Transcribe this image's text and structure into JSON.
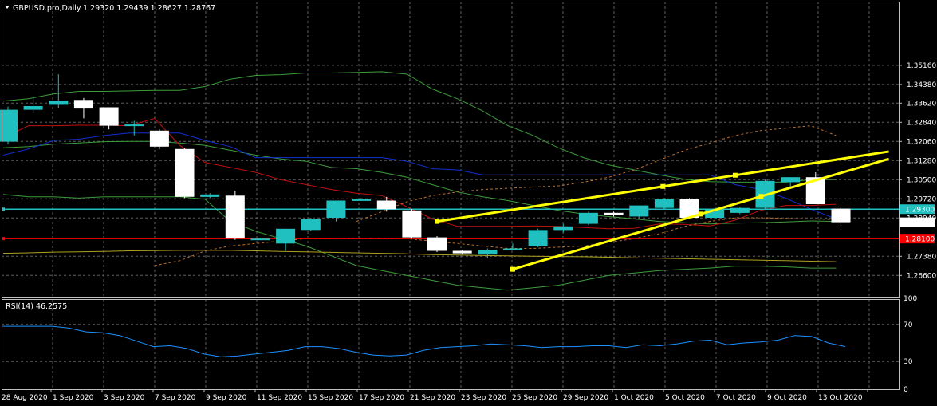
{
  "chart_data": {
    "type": "candlestick",
    "title": "GBPUSD.pro,Daily",
    "ohlc_text": "1.29320 1.29439 1.28627 1.28767",
    "subpanel_title": "RSI(14) 46.2575",
    "y_ticks": [
      "1.35160",
      "1.34380",
      "1.33620",
      "1.32840",
      "1.32060",
      "1.31280",
      "1.30500",
      "1.29720",
      "1.28940",
      "1.27380",
      "1.26600"
    ],
    "ylim": [
      1.266,
      1.3516
    ],
    "x_ticks": [
      "28 Aug 2020",
      "1 Sep 2020",
      "3 Sep 2020",
      "7 Sep 2020",
      "9 Sep 2020",
      "11 Sep 2020",
      "15 Sep 2020",
      "17 Sep 2020",
      "21 Sep 2020",
      "23 Sep 2020",
      "25 Sep 2020",
      "29 Sep 2020",
      "1 Oct 2020",
      "5 Oct 2020",
      "7 Oct 2020",
      "9 Oct 2020",
      "13 Oct 2020"
    ],
    "rsi_ticks": [
      "100",
      "70",
      "30",
      "0"
    ],
    "rsi_value": 46.2575,
    "price_tags": [
      {
        "label": "1.29300",
        "value": 1.293,
        "color": "#20c0c0"
      },
      {
        "label": "1.28767",
        "value": 1.28767,
        "color": "#ffffff"
      },
      {
        "label": "1.28100",
        "value": 1.281,
        "color": "#ff0000"
      }
    ],
    "candles": [
      {
        "date": "27 Aug 2020",
        "open": 1.3205,
        "high": 1.3348,
        "low": 1.3195,
        "close": 1.3335
      },
      {
        "date": "28 Aug 2020",
        "open": 1.3335,
        "high": 1.339,
        "low": 1.332,
        "close": 1.335
      },
      {
        "date": "31 Aug 2020",
        "open": 1.3355,
        "high": 1.348,
        "low": 1.334,
        "close": 1.3372
      },
      {
        "date": "1 Sep 2020",
        "open": 1.3375,
        "high": 1.3383,
        "low": 1.33,
        "close": 1.334
      },
      {
        "date": "2 Sep 2020",
        "open": 1.3345,
        "high": 1.3345,
        "low": 1.3255,
        "close": 1.327
      },
      {
        "date": "3 Sep 2020",
        "open": 1.327,
        "high": 1.329,
        "low": 1.323,
        "close": 1.3275
      },
      {
        "date": "4 Sep 2020",
        "open": 1.325,
        "high": 1.3255,
        "low": 1.3175,
        "close": 1.3185
      },
      {
        "date": "7 Sep 2020",
        "open": 1.3175,
        "high": 1.318,
        "low": 1.2975,
        "close": 1.298
      },
      {
        "date": "8 Sep 2020",
        "open": 1.298,
        "high": 1.2995,
        "low": 1.2975,
        "close": 1.299
      },
      {
        "date": "9 Sep 2020",
        "open": 1.2985,
        "high": 1.3005,
        "low": 1.2805,
        "close": 1.281
      },
      {
        "date": "10 Sep 2020",
        "open": 1.281,
        "high": 1.2812,
        "low": 1.2807,
        "close": 1.281
      },
      {
        "date": "11 Sep 2020",
        "open": 1.279,
        "high": 1.285,
        "low": 1.276,
        "close": 1.285
      },
      {
        "date": "14 Sep 2020",
        "open": 1.2845,
        "high": 1.2895,
        "low": 1.284,
        "close": 1.289
      },
      {
        "date": "15 Sep 2020",
        "open": 1.2895,
        "high": 1.2965,
        "low": 1.288,
        "close": 1.2965
      },
      {
        "date": "16 Sep 2020",
        "open": 1.297,
        "high": 1.2975,
        "low": 1.2965,
        "close": 1.297
      },
      {
        "date": "17 Sep 2020",
        "open": 1.2965,
        "high": 1.298,
        "low": 1.292,
        "close": 1.293
      },
      {
        "date": "18 Sep 2020",
        "open": 1.2925,
        "high": 1.293,
        "low": 1.281,
        "close": 1.2815
      },
      {
        "date": "21 Sep 2020",
        "open": 1.2815,
        "high": 1.282,
        "low": 1.2755,
        "close": 1.276
      },
      {
        "date": "22 Sep 2020",
        "open": 1.276,
        "high": 1.2765,
        "low": 1.2745,
        "close": 1.275
      },
      {
        "date": "23 Sep 2020",
        "open": 1.2745,
        "high": 1.277,
        "low": 1.273,
        "close": 1.2765
      },
      {
        "date": "24 Sep 2020",
        "open": 1.277,
        "high": 1.279,
        "low": 1.2765,
        "close": 1.277
      },
      {
        "date": "25 Sep 2020",
        "open": 1.278,
        "high": 1.285,
        "low": 1.2775,
        "close": 1.2845
      },
      {
        "date": "28 Sep 2020",
        "open": 1.2845,
        "high": 1.287,
        "low": 1.2835,
        "close": 1.286
      },
      {
        "date": "29 Sep 2020",
        "open": 1.287,
        "high": 1.292,
        "low": 1.2865,
        "close": 1.2915
      },
      {
        "date": "30 Sep 2020",
        "open": 1.2915,
        "high": 1.292,
        "low": 1.29,
        "close": 1.2905
      },
      {
        "date": "1 Oct 2020",
        "open": 1.29,
        "high": 1.2945,
        "low": 1.2895,
        "close": 1.2945
      },
      {
        "date": "2 Oct 2020",
        "open": 1.2935,
        "high": 1.2975,
        "low": 1.293,
        "close": 1.297
      },
      {
        "date": "5 Oct 2020",
        "open": 1.297,
        "high": 1.2975,
        "low": 1.289,
        "close": 1.2895
      },
      {
        "date": "6 Oct 2020",
        "open": 1.2895,
        "high": 1.2935,
        "low": 1.289,
        "close": 1.293
      },
      {
        "date": "7 Oct 2020",
        "open": 1.2915,
        "high": 1.294,
        "low": 1.291,
        "close": 1.2935
      },
      {
        "date": "8 Oct 2020",
        "open": 1.2935,
        "high": 1.305,
        "low": 1.293,
        "close": 1.3045
      },
      {
        "date": "9 Oct 2020",
        "open": 1.304,
        "high": 1.306,
        "low": 1.302,
        "close": 1.306
      },
      {
        "date": "12 Oct 2020",
        "open": 1.306,
        "high": 1.308,
        "low": 1.295,
        "close": 1.295
      },
      {
        "date": "13 Oct 2020",
        "open": 1.2932,
        "high": 1.29439,
        "low": 1.28627,
        "close": 1.28767
      }
    ],
    "rsi": [
      68,
      68,
      68,
      68,
      66,
      62,
      61,
      58,
      52,
      46,
      47,
      44,
      38,
      35,
      36,
      38,
      40,
      42,
      46,
      46,
      44,
      40,
      37,
      36,
      37,
      42,
      45,
      46,
      47,
      49,
      48,
      47,
      45,
      46,
      46,
      47,
      47,
      45,
      48,
      47,
      49,
      52,
      53,
      48,
      50,
      51,
      53,
      58,
      57,
      50,
      46
    ],
    "ma_red": [
      1.322,
      1.327,
      1.327,
      1.3272,
      1.3272,
      1.327,
      1.33,
      1.319,
      1.312,
      1.31,
      1.308,
      1.305,
      1.303,
      1.301,
      1.2995,
      1.2985,
      1.294,
      1.289,
      1.286,
      1.286,
      1.286,
      1.2862,
      1.286,
      1.2855,
      1.285,
      1.2852,
      1.287,
      1.2868,
      1.2862,
      1.2885,
      1.2925,
      1.2945,
      1.2945,
      1.295
    ],
    "ma_blue": [
      1.315,
      1.3175,
      1.321,
      1.3215,
      1.323,
      1.324,
      1.324,
      1.324,
      1.321,
      1.3185,
      1.314,
      1.314,
      1.314,
      1.314,
      1.314,
      1.314,
      1.3125,
      1.3095,
      1.309,
      1.307,
      1.307,
      1.307,
      1.307,
      1.307,
      1.307,
      1.307,
      1.307,
      1.307,
      1.307,
      1.303,
      1.301,
      1.2975,
      1.293,
      1.289
    ],
    "bb_green": [
      1.337,
      1.338,
      1.34,
      1.341,
      1.341,
      1.3412,
      1.3414,
      1.3414,
      1.343,
      1.346,
      1.3475,
      1.3478,
      1.3485,
      1.3485,
      1.3487,
      1.349,
      1.348,
      1.342,
      1.338,
      1.333,
      1.327,
      1.323,
      1.318,
      1.314,
      1.311,
      1.309,
      1.307,
      1.3052,
      1.3042,
      1.304,
      1.304,
      1.304,
      1.305,
      1.305
    ],
    "bb_mid": [
      1.318,
      1.3185,
      1.3195,
      1.32,
      1.3205,
      1.3206,
      1.3206,
      1.32,
      1.319,
      1.317,
      1.315,
      1.3135,
      1.3125,
      1.31,
      1.3095,
      1.308,
      1.306,
      1.303,
      1.3,
      1.298,
      1.2965,
      1.2945,
      1.2925,
      1.291,
      1.29,
      1.289,
      1.288,
      1.2875,
      1.287,
      1.2873,
      1.2875,
      1.2878,
      1.2882,
      1.288
    ],
    "bb_low": [
      1.299,
      1.298,
      1.298,
      1.2975,
      1.298,
      1.298,
      1.298,
      1.298,
      1.297,
      1.288,
      1.284,
      1.281,
      1.278,
      1.274,
      1.27,
      1.268,
      1.266,
      1.264,
      1.262,
      1.261,
      1.26,
      1.261,
      1.262,
      1.264,
      1.266,
      1.267,
      1.268,
      1.2685,
      1.269,
      1.2698,
      1.2698,
      1.2695,
      1.269,
      1.269
    ],
    "ma_yellow": [
      1.275,
      1.2752,
      1.2755,
      1.2756,
      1.2758,
      1.276,
      1.2761,
      1.2762,
      1.2762,
      1.2762,
      1.276,
      1.2758,
      1.2756,
      1.2754,
      1.2752,
      1.275,
      1.2748,
      1.2745,
      1.2743,
      1.2741,
      1.274,
      1.2738,
      1.2737,
      1.2736,
      1.2734,
      1.2732,
      1.273,
      1.2728,
      1.2726,
      1.2724,
      1.2722,
      1.272,
      1.2718,
      1.2716
    ],
    "env_upper": [
      null,
      null,
      null,
      null,
      null,
      null,
      null,
      null,
      null,
      null,
      null,
      null,
      null,
      null,
      1.288,
      1.292,
      1.296,
      1.2985,
      1.3,
      1.301,
      1.3015,
      1.302,
      1.3025,
      1.304,
      1.306,
      1.309,
      1.313,
      1.317,
      1.32,
      1.323,
      1.325,
      1.326,
      1.327,
      1.323
    ],
    "env_lower": [
      null,
      null,
      null,
      null,
      null,
      null,
      1.27,
      1.272,
      1.276,
      1.278,
      1.279,
      1.28,
      1.281,
      1.281,
      1.2812,
      1.2812,
      1.281,
      1.28,
      1.279,
      1.278,
      1.277,
      1.277,
      1.2775,
      1.278,
      1.2795,
      1.281,
      1.283,
      1.286,
      1.288,
      1.2895,
      1.2895,
      1.2892,
      1.289,
      1.2888
    ],
    "hlines": [
      {
        "value": 1.293,
        "color": "#20c0c0"
      },
      {
        "value": 1.281,
        "color": "#ff0000"
      }
    ],
    "trendlines": [
      {
        "from": {
          "date": "21 Sep 2020",
          "price": 1.288
        },
        "to": {
          "date": "15 Oct 2020",
          "price": 1.3165
        },
        "color": "#ffff00"
      },
      {
        "from": {
          "date": "24 Sep 2020",
          "price": 1.2685
        },
        "to": {
          "date": "15 Oct 2020",
          "price": 1.3135
        },
        "color": "#ffff00"
      }
    ],
    "grid": true,
    "colors": {
      "bull": "#20c0c0",
      "bear": "#ffffff",
      "background": "#000000",
      "grid": "#606060"
    }
  }
}
